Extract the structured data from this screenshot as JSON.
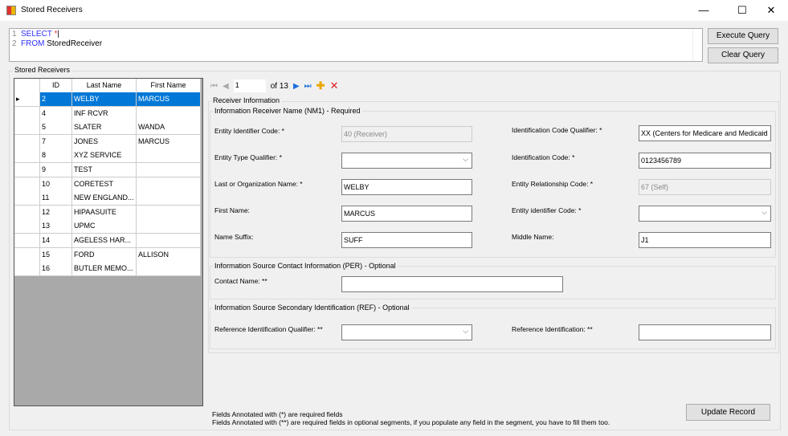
{
  "window": {
    "title": "Stored Receivers",
    "minimize": "—",
    "maximize": "☐",
    "close": "✕"
  },
  "query": {
    "line1_no": "1",
    "line1_kw": "SELECT",
    "line1_rest": " *",
    "line2_no": "2",
    "line2_kw": "FROM",
    "line2_rest": " StoredReceiver"
  },
  "buttons": {
    "execute": "Execute Query",
    "clear": "Clear Query",
    "update": "Update Record"
  },
  "group_title": "Stored Receivers",
  "grid": {
    "headers": [
      "ID",
      "Last Name",
      "First Name"
    ],
    "rows": [
      [
        "2",
        "WELBY",
        "MARCUS"
      ],
      [
        "4",
        "INF RCVR",
        ""
      ],
      [
        "5",
        "SLATER",
        "WANDA"
      ],
      [
        "7",
        "JONES",
        "MARCUS"
      ],
      [
        "8",
        "XYZ SERVICE",
        ""
      ],
      [
        "9",
        "TEST",
        ""
      ],
      [
        "10",
        "CORETEST",
        ""
      ],
      [
        "11",
        "NEW ENGLAND...",
        ""
      ],
      [
        "12",
        "HIPAASUITE",
        ""
      ],
      [
        "13",
        "UPMC",
        ""
      ],
      [
        "14",
        "AGELESS HAR...",
        ""
      ],
      [
        "15",
        "FORD",
        "ALLISON"
      ],
      [
        "16",
        "BUTLER MEMO...",
        ""
      ]
    ]
  },
  "navigator": {
    "position": "1",
    "of": "of 13"
  },
  "form": {
    "section": "Receiver Information",
    "nm1": {
      "title": "Information Receiver Name (NM1) - Required",
      "entity_identifier_code": {
        "label": "Entity Identifier Code: *",
        "value": "40 (Receiver)"
      },
      "entity_type_qualifier": {
        "label": "Entity Type Qualifier: *",
        "value": ""
      },
      "last_name": {
        "label": "Last or Organization Name: *",
        "value": "WELBY"
      },
      "first_name": {
        "label": "First Name:",
        "value": "MARCUS"
      },
      "name_suffix": {
        "label": "Name Suffix:",
        "value": "SUFF"
      },
      "id_code_qualifier": {
        "label": "Identification Code Qualifier: *",
        "value": "XX (Centers for Medicare and Medicaid"
      },
      "id_code": {
        "label": "Identification Code: *",
        "value": "0123456789"
      },
      "entity_relationship_code": {
        "label": "Entity Relationship Code: *",
        "value": "67 (Self)"
      },
      "entity_identifier_code2": {
        "label": "Entity identifier Code: *",
        "value": ""
      },
      "middle_name": {
        "label": "Middle Name:",
        "value": "J1"
      }
    },
    "per": {
      "title": "Information Source Contact Information (PER) - Optional",
      "contact_name": {
        "label": "Contact Name: **",
        "value": ""
      }
    },
    "ref": {
      "title": "Information Source Secondary Identification (REF) - Optional",
      "qualifier": {
        "label": "Reference Identification Qualifier: **",
        "value": ""
      },
      "identification": {
        "label": "Reference Identification: **",
        "value": ""
      }
    }
  },
  "footer": {
    "note1": "Fields Annotated with (*) are required fields",
    "note2": "Fields Annotated with (**) are required fields in optional segments, if you populate any field in the segment, you have to fill them too."
  }
}
